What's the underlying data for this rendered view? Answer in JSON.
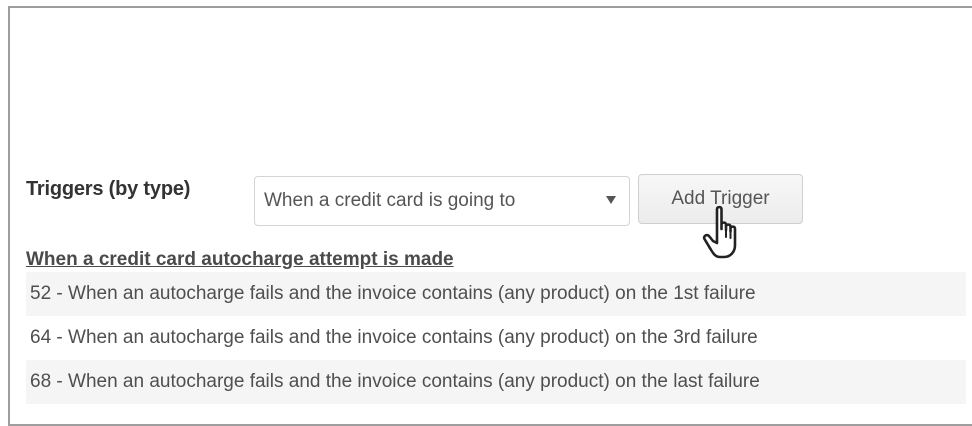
{
  "triggers": {
    "label": "Triggers (by type)",
    "select_value": "When a credit card is going to",
    "add_button": "Add Trigger"
  },
  "section": {
    "heading": "When a credit card autocharge attempt is made",
    "items": [
      "52 - When an autocharge fails and the invoice contains (any product) on the 1st failure",
      "64 - When an autocharge fails and the invoice contains (any product) on the 3rd failure",
      "68 - When an autocharge fails and the invoice contains (any product) on the last failure"
    ]
  },
  "icons": {
    "cursor": "hand-pointer-icon",
    "select_caret": "caret-down-icon"
  }
}
